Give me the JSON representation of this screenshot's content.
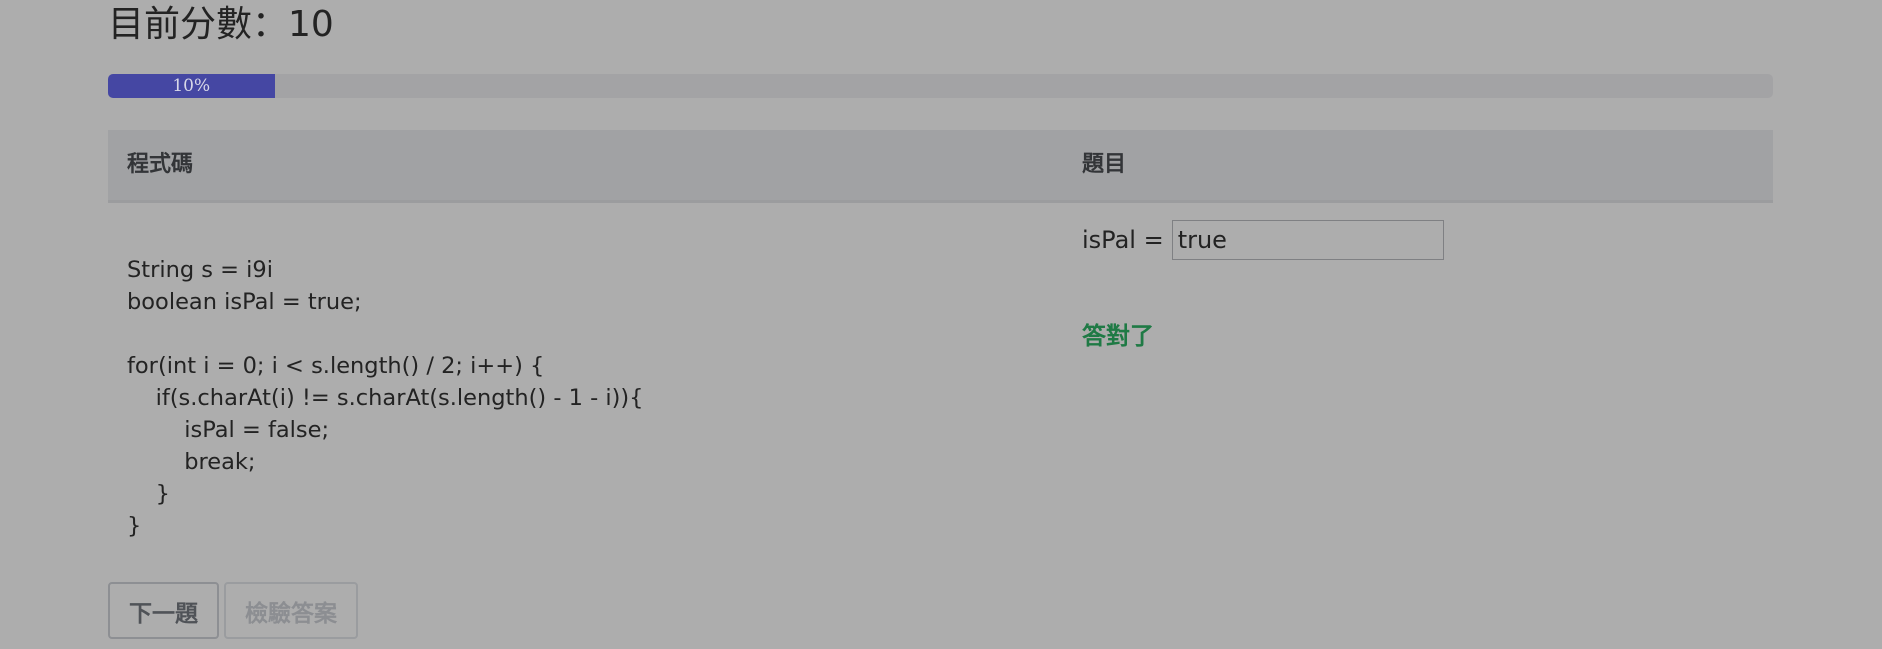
{
  "header": {
    "score_label": "目前分數：10"
  },
  "progress": {
    "percent": 10,
    "label": "10%",
    "color": "#4547a3"
  },
  "table": {
    "col_code": "程式碼",
    "col_question": "題目"
  },
  "code": {
    "lines": [
      "String s = i9i",
      "boolean isPal = true;",
      "",
      "for(int i = 0; i < s.length() / 2; i++) {",
      "    if(s.charAt(i) != s.charAt(s.length() - 1 - i)){",
      "        isPal = false;",
      "        break;",
      "    }",
      "}"
    ]
  },
  "question": {
    "label": "isPal =",
    "input_value": "true",
    "feedback": "答對了",
    "feedback_color": "#1f7a45"
  },
  "buttons": {
    "next_label": "下一題",
    "check_label": "檢驗答案"
  }
}
